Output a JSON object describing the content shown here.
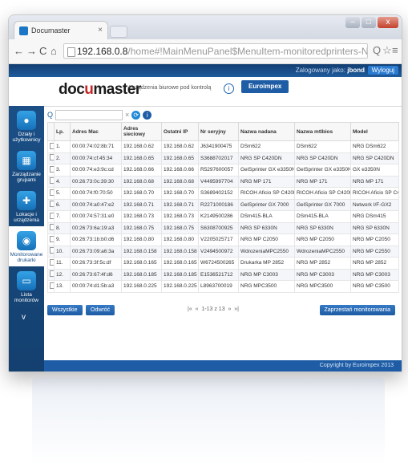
{
  "browser": {
    "tab_title": "Documaster",
    "tab_close": "×",
    "url_host": "192.168.0.8",
    "url_path": "/home#!MainMenuPanel$MenuItem-monitoredprinters-N!",
    "nav_back": "←",
    "nav_forward": "→",
    "nav_reload": "C",
    "nav_home": "⌂",
    "zoom_icon": "Q",
    "star_icon": "☆",
    "menu_icon": "≡",
    "win_min": "–",
    "win_max": "□",
    "win_close": "x"
  },
  "topbar": {
    "logged_in_label": "Zalogowany jako:",
    "user": "jbond",
    "logout": "Wyloguj"
  },
  "header": {
    "logo_pre": "doc",
    "logo_u": "u",
    "logo_post": "master",
    "tagline": "Urządzenia biurowe pod kontrolą",
    "info": "i",
    "company": "Euroimpex"
  },
  "sidebar": {
    "items": [
      {
        "label": "Działy i użytkownicy",
        "icon": "●"
      },
      {
        "label": "Zarządzanie grupami",
        "icon": "▦"
      },
      {
        "label": "Lokacje i urządzenia",
        "icon": "✚"
      },
      {
        "label": "Monitorowane drukarki",
        "icon": "◉"
      },
      {
        "label": "Lista monitorów",
        "icon": "▭"
      }
    ],
    "more": "v"
  },
  "search": {
    "icon": "Q",
    "clear": "×",
    "refresh_icon": "⟳",
    "info_icon": "i"
  },
  "table": {
    "headers": [
      "Lp.",
      "Adres Mac",
      "Adres sieciowy",
      "Ostatni IP",
      "Nr seryjny",
      "Nazwa nadana",
      "Nazwa mtlbios",
      "Model"
    ],
    "rows": [
      [
        "1.",
        "00:00:74:02:8b:71",
        "192.168.0.62",
        "192.168.0.62",
        "J6341900475",
        "DSm622",
        "DSm622",
        "NRG DSm622"
      ],
      [
        "2.",
        "00:00:74:cf:45:34",
        "192.168.0.65",
        "192.168.0.65",
        "S3688702017",
        "NRG SP C420DN",
        "NRG SP C420DN",
        "NRG SP C420DN"
      ],
      [
        "3.",
        "00:00:74:e3:9c:cd",
        "192.168.0.66",
        "192.168.0.66",
        "R5297600057",
        "GelSprinter GX e3350N",
        "GelSprinter GX e3350N",
        "GX e3350N"
      ],
      [
        "4.",
        "00:26:73:0c:39:30",
        "192.168.0.68",
        "192.168.0.68",
        "V4495997704",
        "NRG MP 171",
        "NRG MP 171",
        "NRG MP 171"
      ],
      [
        "5.",
        "00:00:74:f0:70:50",
        "192.168.0.70",
        "192.168.0.70",
        "S3689402152",
        "RICOH Aficio SP C420DN",
        "RICOH Aficio SP C420DN",
        "RICOH Aficio SP C420DN"
      ],
      [
        "6.",
        "00:00:74:a0:47:e2",
        "192.168.0.71",
        "192.168.0.71",
        "R2271000186",
        "GelSprinter GX 7000",
        "GelSprinter GX 7000",
        "Network I/F-GX2"
      ],
      [
        "7.",
        "00:00:74:57:31:e0",
        "192.168.0.73",
        "192.168.0.73",
        "K2149500286",
        "DSm415-BLA",
        "DSm415-BLA",
        "NRG DSm415"
      ],
      [
        "8.",
        "00:26:73:6a:19:a3",
        "192.168.0.75",
        "192.168.0.75",
        "S6308700925",
        "NRG SP 6330N",
        "NRG SP 6330N",
        "NRG SP 6330N"
      ],
      [
        "9.",
        "00:26:73:1b:b0:d6",
        "192.168.0.80",
        "192.168.0.80",
        "V2205025717",
        "NRG MP C2050",
        "NRG MP C2050",
        "NRG MP C2050"
      ],
      [
        "10.",
        "00:26:73:09:a6:3a",
        "192.168.0.158",
        "192.168.0.158",
        "V2494500972",
        "WdrozeniaMPC2550",
        "WdrozeniaMPC2550",
        "NRG MP C2550"
      ],
      [
        "11.",
        "00:26:73:3f:5c:df",
        "192.168.0.165",
        "192.168.0.165",
        "W6724500265",
        "Drukarka MP 2852",
        "NRG MP 2852",
        "NRG MP 2852"
      ],
      [
        "12.",
        "00:26:73:67:4f:d6",
        "192.168.0.185",
        "192.168.0.185",
        "E1536521712",
        "NRG MP C3003",
        "NRG MP C3003",
        "NRG MP C3003"
      ],
      [
        "13.",
        "00:00:74:d1:5b:a3",
        "192.168.0.225",
        "192.168.0.225",
        "L8963700019",
        "NRG MPC3500",
        "NRG MPC3500",
        "NRG MP C3500"
      ]
    ]
  },
  "actions": {
    "select_all": "Wszystkie",
    "deselect": "Odwróć",
    "pager": "1-13 z 13",
    "first": "|«",
    "prev": "«",
    "next": "»",
    "last": "»|",
    "stop_monitoring": "Zaprzestań monitorowania"
  },
  "footer": {
    "copyright": "Copyright by Euroimpex 2013"
  },
  "colors": {
    "brand_blue": "#1e5da6",
    "sidebar_blue": "#1b4f86",
    "logo_red": "#c62828"
  }
}
